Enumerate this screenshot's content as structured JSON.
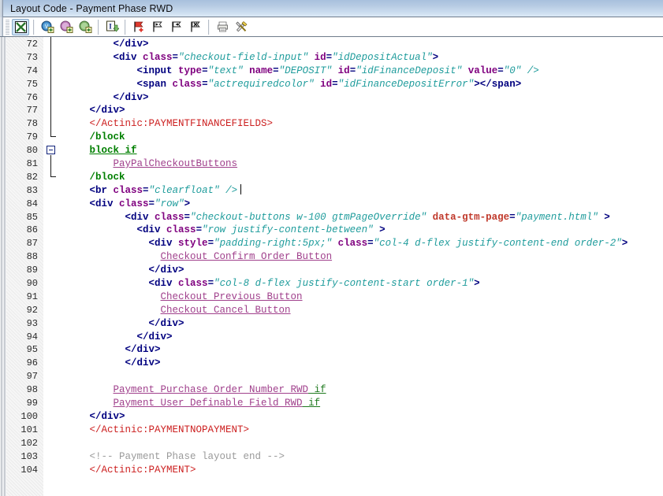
{
  "window": {
    "title": "Layout Code  - Payment Phase RWD"
  },
  "toolbar": {
    "buttons": [
      {
        "name": "grid-selector-icon",
        "label": "Select Layout",
        "active": true
      },
      {
        "name": "add-variable-icon",
        "label": "Insert Variable"
      },
      {
        "name": "add-function-icon",
        "label": "Insert Function"
      },
      {
        "name": "add-list-icon",
        "label": "Insert List"
      },
      {
        "name": "insert-text-icon",
        "label": "Insert Text"
      },
      {
        "name": "add-flag-icon",
        "label": "Add Block"
      },
      {
        "name": "flag-next-icon",
        "label": "Next Block"
      },
      {
        "name": "flag-prev-icon",
        "label": "Previous Block"
      },
      {
        "name": "delete-flag-icon",
        "label": "Delete Block"
      },
      {
        "name": "print-icon",
        "label": "Print"
      },
      {
        "name": "tools-icon",
        "label": "Tools"
      }
    ]
  },
  "editor": {
    "first_line": 72,
    "caret_line": 83,
    "lines": [
      {
        "n": 72,
        "indent": 4,
        "tokens": [
          {
            "c": "t-tag",
            "t": "</div>"
          }
        ]
      },
      {
        "n": 73,
        "indent": 4,
        "tokens": [
          {
            "c": "t-tag",
            "t": "<div "
          },
          {
            "c": "t-attr",
            "t": "class"
          },
          {
            "c": "t-eq",
            "t": "="
          },
          {
            "c": "t-val",
            "t": "\"checkout-field-input\""
          },
          {
            "c": "t-plain",
            "t": " "
          },
          {
            "c": "t-attr",
            "t": "id"
          },
          {
            "c": "t-eq",
            "t": "="
          },
          {
            "c": "t-val",
            "t": "\"idDepositActual\""
          },
          {
            "c": "t-tag",
            "t": ">"
          }
        ]
      },
      {
        "n": 74,
        "indent": 6,
        "tokens": [
          {
            "c": "t-tag",
            "t": "<input "
          },
          {
            "c": "t-attr",
            "t": "type"
          },
          {
            "c": "t-eq",
            "t": "="
          },
          {
            "c": "t-val",
            "t": "\"text\""
          },
          {
            "c": "t-plain",
            "t": " "
          },
          {
            "c": "t-attr",
            "t": "name"
          },
          {
            "c": "t-eq",
            "t": "="
          },
          {
            "c": "t-val",
            "t": "\"DEPOSIT\""
          },
          {
            "c": "t-plain",
            "t": " "
          },
          {
            "c": "t-attr",
            "t": "id"
          },
          {
            "c": "t-eq",
            "t": "="
          },
          {
            "c": "t-val",
            "t": "\"idFinanceDeposit\""
          },
          {
            "c": "t-plain",
            "t": " "
          },
          {
            "c": "t-attr",
            "t": "value"
          },
          {
            "c": "t-eq",
            "t": "="
          },
          {
            "c": "t-val",
            "t": "\"0\""
          },
          {
            "c": "t-val",
            "t": " />"
          }
        ]
      },
      {
        "n": 75,
        "indent": 6,
        "tokens": [
          {
            "c": "t-tag",
            "t": "<span "
          },
          {
            "c": "t-attr",
            "t": "class"
          },
          {
            "c": "t-eq",
            "t": "="
          },
          {
            "c": "t-val",
            "t": "\"actrequiredcolor\""
          },
          {
            "c": "t-plain",
            "t": " "
          },
          {
            "c": "t-attr",
            "t": "id"
          },
          {
            "c": "t-eq",
            "t": "="
          },
          {
            "c": "t-val",
            "t": "\"idFinanceDepositError\""
          },
          {
            "c": "t-tag",
            "t": "></span>"
          }
        ]
      },
      {
        "n": 76,
        "indent": 4,
        "tokens": [
          {
            "c": "t-tag",
            "t": "</div>"
          }
        ]
      },
      {
        "n": 77,
        "indent": 2,
        "tokens": [
          {
            "c": "t-tag",
            "t": "</div>"
          }
        ]
      },
      {
        "n": 78,
        "indent": 2,
        "tokens": [
          {
            "c": "t-actinic",
            "t": "</Actinic:PAYMENTFINANCEFIELDS>"
          }
        ]
      },
      {
        "n": 79,
        "indent": 2,
        "tokens": [
          {
            "c": "t-block",
            "t": "/block"
          }
        ]
      },
      {
        "n": 80,
        "indent": 2,
        "tokens": [
          {
            "c": "t-blockif",
            "t": "block if"
          }
        ]
      },
      {
        "n": 81,
        "indent": 4,
        "tokens": [
          {
            "c": "t-link",
            "t": "PayPalCheckoutButtons"
          }
        ]
      },
      {
        "n": 82,
        "indent": 2,
        "tokens": [
          {
            "c": "t-block",
            "t": "/block"
          }
        ]
      },
      {
        "n": 83,
        "indent": 2,
        "caret": true,
        "tokens": [
          {
            "c": "t-tag",
            "t": "<br "
          },
          {
            "c": "t-attr",
            "t": "class"
          },
          {
            "c": "t-eq",
            "t": "="
          },
          {
            "c": "t-val",
            "t": "\"clearfloat\""
          },
          {
            "c": "t-val",
            "t": " />"
          }
        ]
      },
      {
        "n": 84,
        "indent": 2,
        "tokens": [
          {
            "c": "t-tag",
            "t": "<div "
          },
          {
            "c": "t-attr",
            "t": "class"
          },
          {
            "c": "t-eq",
            "t": "="
          },
          {
            "c": "t-val",
            "t": "\"row\""
          },
          {
            "c": "t-tag",
            "t": ">"
          }
        ]
      },
      {
        "n": 85,
        "indent": 5,
        "tokens": [
          {
            "c": "t-tag",
            "t": "<div "
          },
          {
            "c": "t-attr",
            "t": "class"
          },
          {
            "c": "t-eq",
            "t": "="
          },
          {
            "c": "t-val",
            "t": "\"checkout-buttons w-100 gtmPageOverride\""
          },
          {
            "c": "t-plain",
            "t": " "
          },
          {
            "c": "t-attr2",
            "t": "data-gtm-page"
          },
          {
            "c": "t-eq",
            "t": "="
          },
          {
            "c": "t-val",
            "t": "\"payment.html\""
          },
          {
            "c": "t-tag",
            "t": " >"
          }
        ]
      },
      {
        "n": 86,
        "indent": 6,
        "tokens": [
          {
            "c": "t-tag",
            "t": "<div "
          },
          {
            "c": "t-attr",
            "t": "class"
          },
          {
            "c": "t-eq",
            "t": "="
          },
          {
            "c": "t-val",
            "t": "\"row justify-content-between\""
          },
          {
            "c": "t-tag",
            "t": " >"
          }
        ]
      },
      {
        "n": 87,
        "indent": 7,
        "tokens": [
          {
            "c": "t-tag",
            "t": "<div "
          },
          {
            "c": "t-attr",
            "t": "style"
          },
          {
            "c": "t-eq",
            "t": "="
          },
          {
            "c": "t-val",
            "t": "\"padding-right:5px;\""
          },
          {
            "c": "t-plain",
            "t": " "
          },
          {
            "c": "t-attr",
            "t": "class"
          },
          {
            "c": "t-eq",
            "t": "="
          },
          {
            "c": "t-val",
            "t": "\"col-4 d-flex justify-content-end order-2\""
          },
          {
            "c": "t-tag",
            "t": ">"
          }
        ]
      },
      {
        "n": 88,
        "indent": 8,
        "tokens": [
          {
            "c": "t-link",
            "t": "Checkout Confirm Order Button"
          }
        ]
      },
      {
        "n": 89,
        "indent": 7,
        "tokens": [
          {
            "c": "t-tag",
            "t": "</div>"
          }
        ]
      },
      {
        "n": 90,
        "indent": 7,
        "tokens": [
          {
            "c": "t-tag",
            "t": "<div "
          },
          {
            "c": "t-attr",
            "t": "class"
          },
          {
            "c": "t-eq",
            "t": "="
          },
          {
            "c": "t-val",
            "t": "\"col-8 d-flex justify-content-start order-1\""
          },
          {
            "c": "t-tag",
            "t": ">"
          }
        ]
      },
      {
        "n": 91,
        "indent": 8,
        "tokens": [
          {
            "c": "t-link",
            "t": "Checkout Previous Button"
          }
        ]
      },
      {
        "n": 92,
        "indent": 8,
        "tokens": [
          {
            "c": "t-link",
            "t": "Checkout Cancel Button"
          }
        ]
      },
      {
        "n": 93,
        "indent": 7,
        "tokens": [
          {
            "c": "t-tag",
            "t": "</div>"
          }
        ]
      },
      {
        "n": 94,
        "indent": 6,
        "tokens": [
          {
            "c": "t-tag",
            "t": "</div>"
          }
        ]
      },
      {
        "n": 95,
        "indent": 5,
        "tokens": [
          {
            "c": "t-tag",
            "t": "</div>"
          }
        ]
      },
      {
        "n": 96,
        "indent": 5,
        "tokens": [
          {
            "c": "t-tag",
            "t": "</div>"
          }
        ]
      },
      {
        "n": 97,
        "indent": 0,
        "tokens": []
      },
      {
        "n": 98,
        "indent": 4,
        "tokens": [
          {
            "c": "t-link",
            "t": "Payment Purchase Order Number RWD"
          },
          {
            "c": "t-ifsuffix",
            "t": " if"
          }
        ]
      },
      {
        "n": 99,
        "indent": 4,
        "tokens": [
          {
            "c": "t-link",
            "t": "Payment User Definable Field RWD"
          },
          {
            "c": "t-ifsuffix",
            "t": " if"
          }
        ]
      },
      {
        "n": 100,
        "indent": 2,
        "tokens": [
          {
            "c": "t-tag",
            "t": "</div>"
          }
        ]
      },
      {
        "n": 101,
        "indent": 2,
        "tokens": [
          {
            "c": "t-actinic",
            "t": "</Actinic:PAYMENTNOPAYMENT>"
          }
        ]
      },
      {
        "n": 102,
        "indent": 0,
        "tokens": []
      },
      {
        "n": 103,
        "indent": 2,
        "tokens": [
          {
            "c": "t-comment",
            "t": "<!-- Payment Phase layout end -->"
          }
        ]
      },
      {
        "n": 104,
        "indent": 2,
        "tokens": [
          {
            "c": "t-actinic",
            "t": "</Actinic:PAYMENT>"
          }
        ]
      }
    ],
    "fold": {
      "guide_from_line": 72,
      "guide_to_line": 79,
      "collapsible_line": 80,
      "inner_to_line": 82
    }
  },
  "colors": {
    "title_gradient_top": "#a8c0dd",
    "title_gradient_bottom": "#dce9f6",
    "tag": "#00007f",
    "attribute": "#7f007f",
    "attribute_alt": "#c0392b",
    "string": "#1f9c9c",
    "actinic": "#cc1f1f",
    "block": "#007f00",
    "link": "#a0408c",
    "comment": "#9a9a9a",
    "gutter_bg": "#f3f3f3",
    "toolbar_active": "#cfe4f7"
  }
}
